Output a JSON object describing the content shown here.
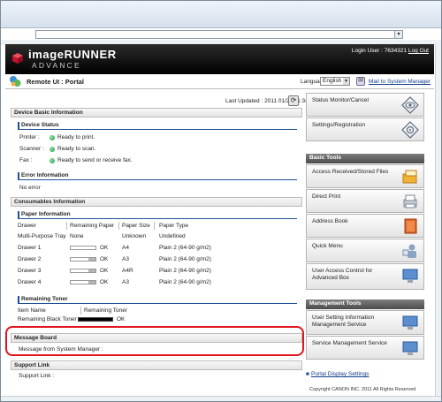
{
  "browser": {
    "address": "",
    "dropdown_glyph": "▾"
  },
  "header": {
    "brand_line1": "imageRUNNER",
    "brand_line2": "ADVANCE",
    "login_label": "Login User : 7634321",
    "logout_label": "Log Out"
  },
  "portal": {
    "title": "Remote UI : Portal",
    "language_label": "Language:",
    "language_value": "English",
    "mail_link": "Mail to System Manager",
    "last_updated": "Last Updated : 2011 01/27 11:34:08"
  },
  "device_basic": {
    "header": "Device Basic Information",
    "status_header": "Device Status",
    "status": [
      {
        "label": "Printer :",
        "value": "Ready to print."
      },
      {
        "label": "Scanner :",
        "value": "Ready to scan."
      },
      {
        "label": "Fax :",
        "value": "Ready to send or receive fax."
      }
    ],
    "error_header": "Error Information",
    "error_value": "No error"
  },
  "consumables": {
    "header": "Consumables Information",
    "paper_header": "Paper Information",
    "columns": [
      "Drawer",
      "Remaining Paper",
      "Paper Size",
      "Paper Type"
    ],
    "rows": [
      {
        "drawer": "Multi-Purpose Tray",
        "remaining": "None",
        "level": null,
        "size": "Unknown",
        "type": "Undefined"
      },
      {
        "drawer": "Drawer 1",
        "remaining": "OK",
        "level": 0.0,
        "size": "A4",
        "type": "Plain 2 (64-90 g/m2)"
      },
      {
        "drawer": "Drawer 2",
        "remaining": "OK",
        "level": 0.3,
        "size": "A3",
        "type": "Plain 2 (64-90 g/m2)"
      },
      {
        "drawer": "Drawer 3",
        "remaining": "OK",
        "level": 0.3,
        "size": "A4R",
        "type": "Plain 2 (64-90 g/m2)"
      },
      {
        "drawer": "Drawer 4",
        "remaining": "OK",
        "level": 0.3,
        "size": "A3",
        "type": "Plain 2 (64-90 g/m2)"
      }
    ],
    "toner_header": "Remaining Toner",
    "toner_columns": [
      "Item Name",
      "Remaining Toner"
    ],
    "toner_rows": [
      {
        "name": "Remaining Black Toner :",
        "status": "OK",
        "level": 1.0
      }
    ]
  },
  "message_board": {
    "header": "Message Board",
    "label": "Message from System Manager :"
  },
  "support": {
    "header": "Support Link",
    "label": "Support Link :"
  },
  "right": {
    "status_monitor": "Status Monitor/Cancel",
    "settings": "Settings/Registration",
    "basic_tools_header": "Basic Tools",
    "basic_tools": [
      "Access Received/Stored Files",
      "Direct Print",
      "Address Book",
      "Quick Menu",
      "User Access Control for Advanced Box"
    ],
    "management_header": "Management Tools",
    "management_tools": [
      "User Setting Information Management Service",
      "Service Management Service"
    ],
    "portal_settings": "Portal Display Settings",
    "copyright": "Copyright CANON INC. 2011 All Rights Reserved"
  },
  "colors": {
    "highlight": "#e0141c",
    "link": "#113b8a",
    "ready_dot": "#1e9a44"
  }
}
